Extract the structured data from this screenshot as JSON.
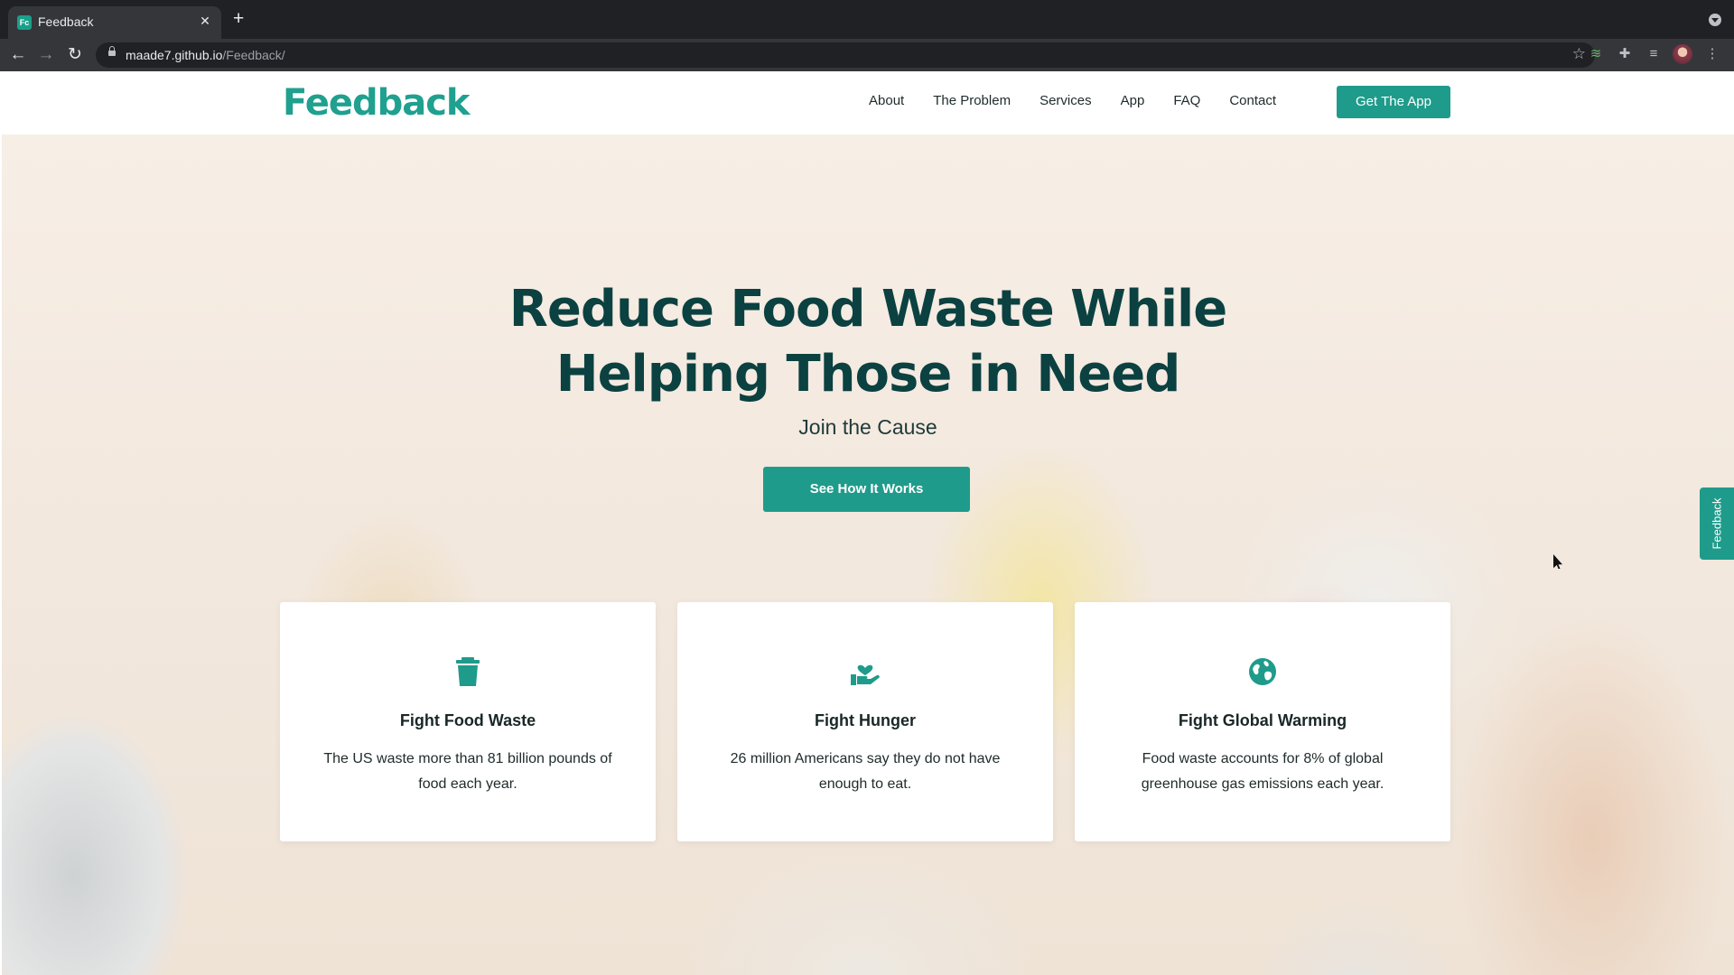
{
  "browser": {
    "tab_title": "Feedback",
    "tab_favicon_text": "Fc",
    "url_host": "maade7.github.io",
    "url_path": "/Feedback/"
  },
  "site": {
    "logo": "Feedback",
    "nav": [
      "About",
      "The Problem",
      "Services",
      "App",
      "FAQ",
      "Contact"
    ],
    "get_app_label": "Get The App"
  },
  "hero": {
    "title_line1": "Reduce Food Waste While",
    "title_line2": "Helping Those in Need",
    "subtitle": "Join the Cause",
    "cta_label": "See How It Works"
  },
  "cards": [
    {
      "icon": "trash-icon",
      "title": "Fight Food Waste",
      "text": "The US waste more than 81 billion pounds of food each year."
    },
    {
      "icon": "hand-heart-icon",
      "title": "Fight Hunger",
      "text": "26 million Americans say they do not have enough to eat."
    },
    {
      "icon": "globe-icon",
      "title": "Fight Global Warming",
      "text": "Food waste accounts for 8% of global greenhouse gas emissions each year."
    }
  ],
  "feedback_tab_label": "Feedback",
  "colors": {
    "accent": "#1f9b8b",
    "logo": "#20a08f",
    "hero_title": "#0b4141"
  }
}
